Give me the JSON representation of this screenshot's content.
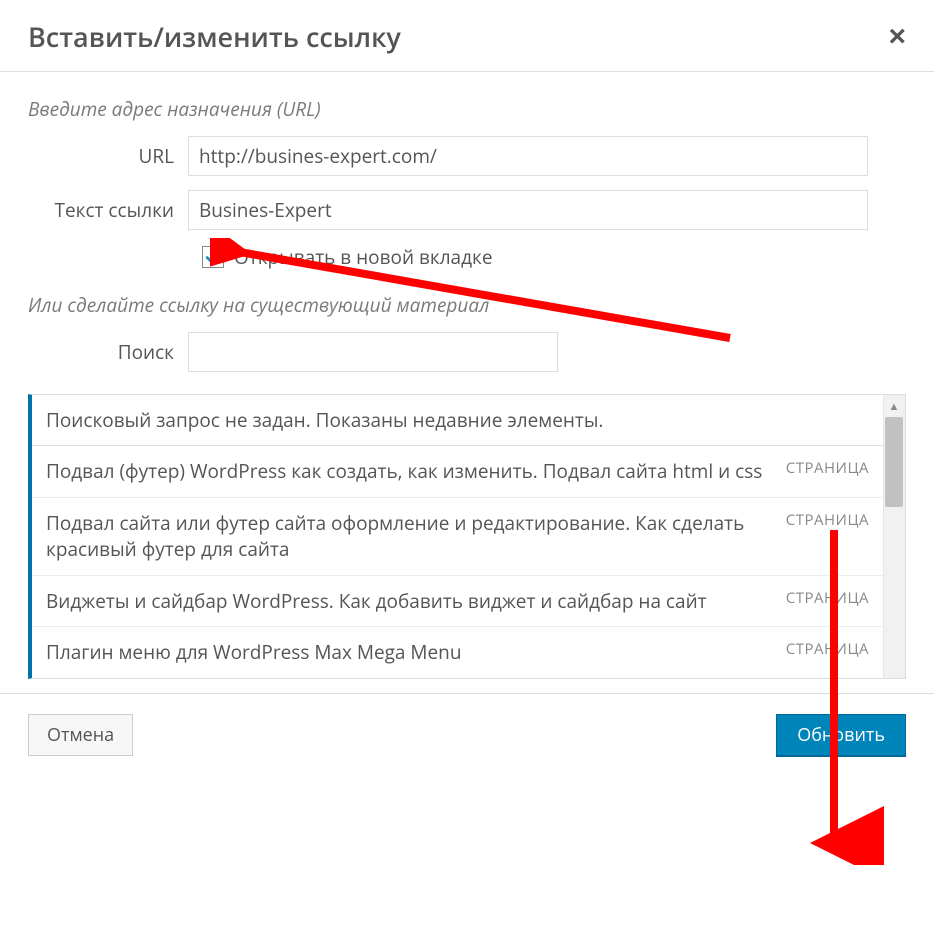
{
  "dialog": {
    "title": "Вставить/изменить ссылку"
  },
  "section1_label": "Введите адрес назначения (URL)",
  "url": {
    "label": "URL",
    "value": "http://busines-expert.com/"
  },
  "link_text": {
    "label": "Текст ссылки",
    "value": "Busines-Expert"
  },
  "new_tab": {
    "label": "Открывать в новой вкладке",
    "checked": true
  },
  "section2_label": "Или сделайте ссылку на существующий материал",
  "search": {
    "label": "Поиск",
    "value": ""
  },
  "results": {
    "header": "Поисковый запрос не задан. Показаны недавние элементы.",
    "type_label": "СТРАНИЦА",
    "items": [
      {
        "title": "Подвал (футер) WordPress как создать, как изменить. Подвал сайта html и css",
        "type": "СТРАНИЦА"
      },
      {
        "title": "Подвал сайта или футер сайта оформление и редактирование. Как сделать красивый футер для сайта",
        "type": "СТРАНИЦА"
      },
      {
        "title": "Виджеты и сайдбар WordPress. Как добавить виджет и сайдбар на сайт",
        "type": "СТРАНИЦА"
      },
      {
        "title": "Плагин меню для WordPress Max Mega Menu",
        "type": "СТРАНИЦА"
      }
    ]
  },
  "footer": {
    "cancel": "Отмена",
    "submit": "Обновить"
  }
}
